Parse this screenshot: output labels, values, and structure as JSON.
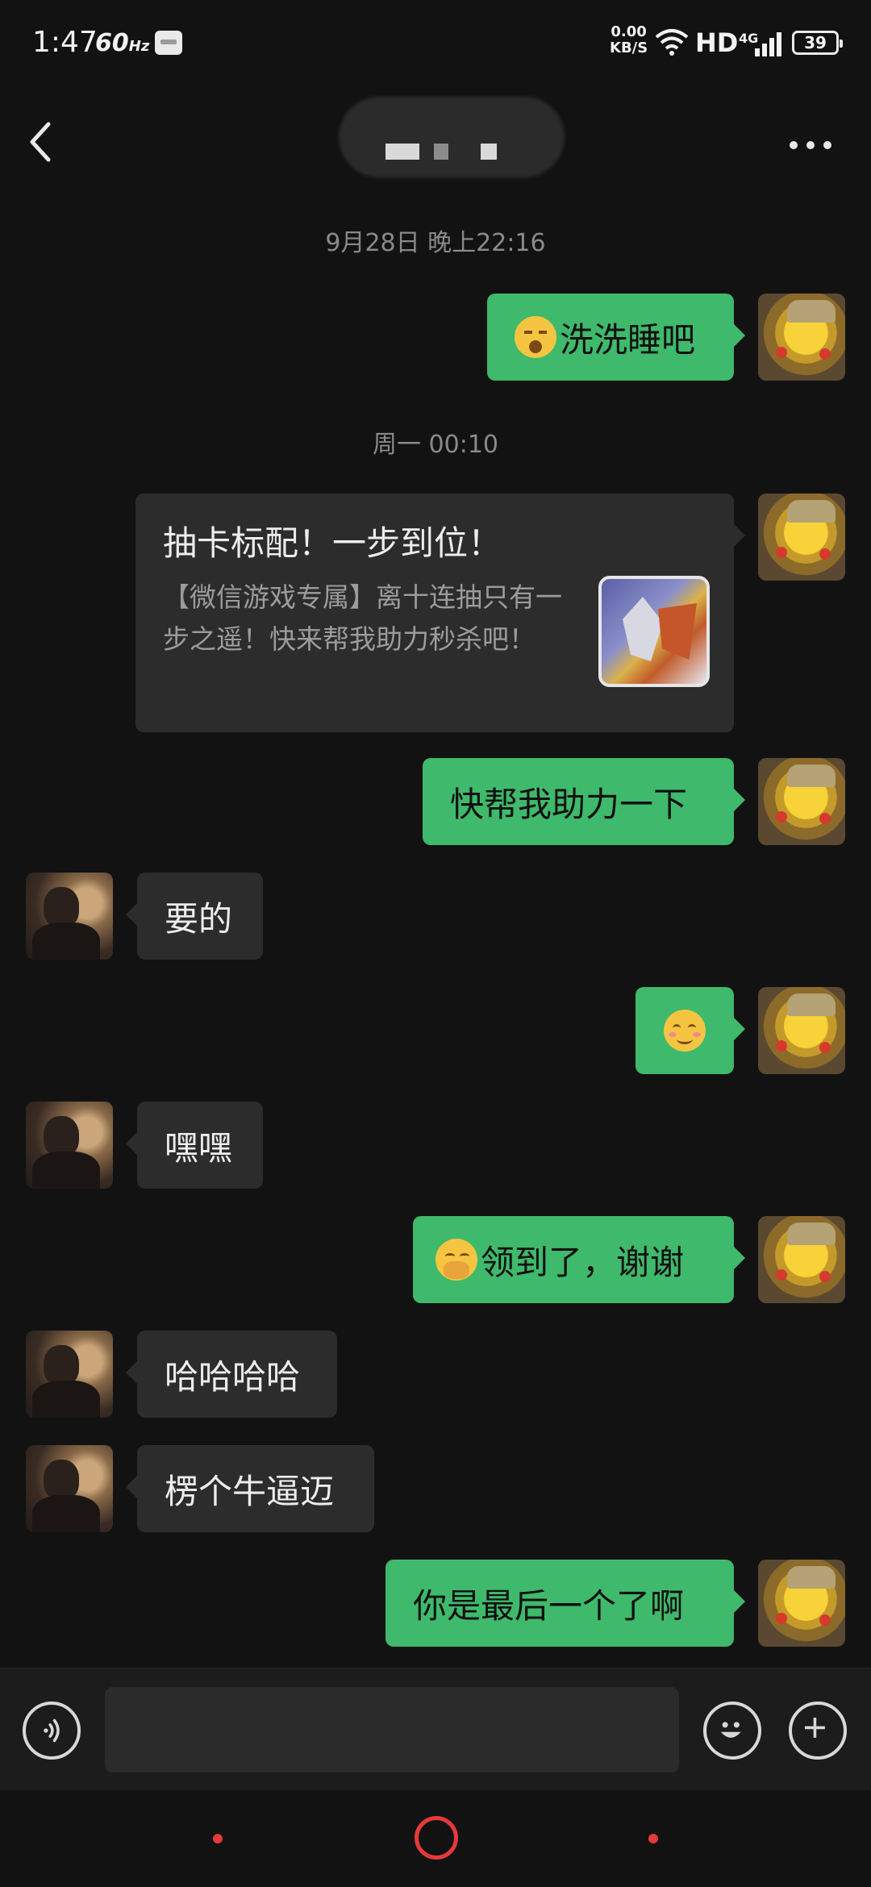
{
  "status_bar": {
    "time": "1:47",
    "refresh_rate": "60",
    "refresh_unit": "Hz",
    "net_speed_value": "0.00",
    "net_speed_unit": "KB/S",
    "hd_label": "HD",
    "network_type": "4G",
    "battery_level": "39"
  },
  "header": {
    "icons": {
      "back": "back-icon",
      "more": "more-icon"
    }
  },
  "timestamps": [
    "9月28日 晚上22:16",
    "周一 00:10"
  ],
  "messages": [
    {
      "sender": "me",
      "emoji": "sleep-emoji",
      "text": "洗洗睡吧"
    },
    {
      "sender": "me",
      "type": "share_card",
      "card": {
        "title": "抽卡标配！一步到位！",
        "description": "【微信游戏专属】离十连抽只有一步之遥！快来帮我助力秒杀吧！"
      }
    },
    {
      "sender": "me",
      "text": "快帮我助力一下"
    },
    {
      "sender": "them",
      "text": "要的"
    },
    {
      "sender": "me",
      "emoji": "smile-emoji",
      "text": ""
    },
    {
      "sender": "them",
      "text": "嘿嘿"
    },
    {
      "sender": "me",
      "emoji": "hehe-emoji",
      "text": "领到了，谢谢"
    },
    {
      "sender": "them",
      "text": "哈哈哈哈"
    },
    {
      "sender": "them",
      "text": "楞个牛逼迈"
    },
    {
      "sender": "me",
      "text": "你是最后一个了啊"
    }
  ],
  "input_bar": {
    "value": "",
    "placeholder": "",
    "icons": {
      "voice": "voice-icon",
      "emoji": "emoji-icon",
      "plus": "plus-icon"
    }
  },
  "colors": {
    "background": "#121212",
    "my_bubble": "#3fb96b",
    "their_bubble": "#2c2c2c",
    "nav_accent": "#e53a3a"
  }
}
